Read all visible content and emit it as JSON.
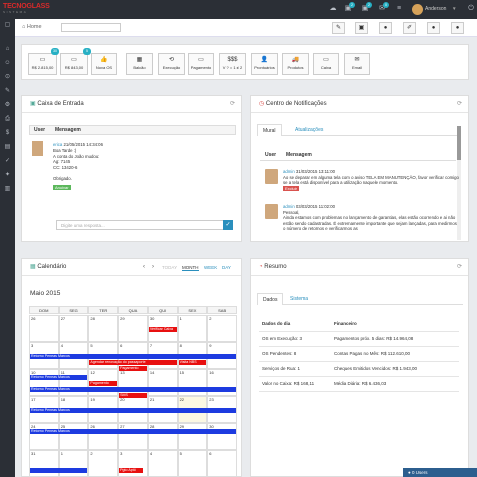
{
  "app": {
    "logo_main": "TECNOGLASS",
    "logo_sub": "SISTEMA"
  },
  "topbar": {
    "icons": [
      "cloud-icon",
      "chat-icon",
      "message-icon",
      "mail-icon",
      "list-icon"
    ],
    "badges": [
      "2",
      "2",
      "0"
    ],
    "user_name": "Anderson"
  },
  "breadcrumb": {
    "home": "Home"
  },
  "header_buttons": [
    "wrench-icon",
    "lock-icon",
    "info-icon",
    "edit-icon",
    "user-icon",
    "user2-icon"
  ],
  "shortcuts": [
    {
      "label": "R$ 2.815,00",
      "glyph": "▭",
      "badge": "30",
      "badge_color": "#27b0c4"
    },
    {
      "label": "R$ 843,00",
      "glyph": "▭",
      "badge": "5",
      "badge_color": "#27b0c4"
    },
    {
      "label": "Nova OS",
      "glyph": "👍",
      "badge": "",
      "badge_color": ""
    },
    {
      "label": "Balcão",
      "glyph": "▦",
      "badge": "",
      "badge_color": ""
    },
    {
      "label": "Execução",
      "glyph": "⟲",
      "badge": "",
      "badge_color": ""
    },
    {
      "label": "Pagamento",
      "glyph": "▭",
      "badge": "",
      "badge_color": ""
    },
    {
      "label": "V ? = 1 ≠ 2",
      "glyph": "$$$",
      "badge": "",
      "badge_color": ""
    },
    {
      "label": "Prontuários",
      "glyph": "👤",
      "badge": "",
      "badge_color": ""
    },
    {
      "label": "Produtos",
      "glyph": "🚚",
      "badge": "",
      "badge_color": ""
    },
    {
      "label": "Caixa",
      "glyph": "▭",
      "badge": "",
      "badge_color": ""
    },
    {
      "label": "Email",
      "glyph": "✉",
      "badge": "",
      "badge_color": ""
    }
  ],
  "inbox": {
    "title": "Caixa de Entrada",
    "col_user": "User",
    "col_msg": "Mensagem",
    "message": {
      "author": "erica",
      "date": "21/05/2015 14:34:06",
      "lines": [
        "Boa Tarde :)",
        "A conta do João mudou:",
        "Ag: 7145",
        "CC: 13420-6",
        "",
        "Obrigado."
      ],
      "attachment": "Anuivar"
    },
    "reply_placeholder": "Digite uma resposta..."
  },
  "notifications": {
    "title": "Centro de Notificações",
    "tabs": [
      "Mural",
      "Atualizações"
    ],
    "col_user": "User",
    "col_msg": "Mensagem",
    "items": [
      {
        "author": "admin",
        "date": "31/03/2015 13:11:00",
        "text": "Ao se deparar em alguma tela com o aviso TELA EM MANUTENÇÃO, favor verificar comigo se a tela está disponível para a utilização naquele momento.",
        "tag": "Excluir"
      },
      {
        "author": "admin",
        "date": "03/03/2015 11:02:00",
        "text": "Pessoal,\nAinda estamos com problemas no lançamento de garantias, elas estão ocorrendo e ai não estão sendo cadastradas. É extremamente importante que sejam lançadas, para medirmos o número de retornos e verificarmos as",
        "tag": ""
      }
    ]
  },
  "calendar": {
    "title": "Calendário",
    "views": [
      "TODAY",
      "MONTH",
      "WEEK",
      "DAY"
    ],
    "month": "Maio 2015",
    "weekdays": [
      "DOM",
      "SEG",
      "TER",
      "QUA",
      "QUI",
      "SEX",
      "SAB"
    ],
    "rows": [
      [
        "26",
        "27",
        "28",
        "29",
        "30",
        "1",
        "2"
      ],
      [
        "3",
        "4",
        "5",
        "6",
        "7",
        "8",
        "9"
      ],
      [
        "10",
        "11",
        "12",
        "13",
        "14",
        "15",
        "16"
      ],
      [
        "17",
        "18",
        "19",
        "20",
        "21",
        "22",
        "23"
      ],
      [
        "24",
        "25",
        "26",
        "27",
        "28",
        "29",
        "30"
      ],
      [
        "31",
        "1",
        "2",
        "3",
        "4",
        "5",
        "6"
      ]
    ],
    "events": [
      {
        "text": "Verificar Caixa",
        "color": "r"
      },
      {
        "text": "Retorno Peneas Marcos",
        "color": "b"
      },
      {
        "text": "Agendar renovação do passaporte",
        "color": "r"
      },
      {
        "text": "Visita NBS",
        "color": "r"
      },
      {
        "text": "Pagamento",
        "color": "r"
      },
      {
        "text": "Retorno Peneas Marcos",
        "color": "b"
      },
      {
        "text": "Pagamento",
        "color": "r"
      },
      {
        "text": "Retorno Peneas Marcos",
        "color": "b"
      },
      {
        "text": "SMS",
        "color": "r"
      },
      {
        "text": "Retorno Peneas Marcos",
        "color": "b"
      },
      {
        "text": "Retorno Peneas Marcos",
        "color": "b"
      },
      {
        "text": "Pgto Aptö",
        "color": "r"
      }
    ]
  },
  "resumo": {
    "title": "Resumo",
    "tabs": [
      "Dados",
      "Sistema"
    ],
    "head": [
      "Dados do dia",
      "Financeiro"
    ],
    "rows": [
      [
        "OS em Execução: 3",
        "Pagamentos próx. 5 dias: R$ 14.964,08"
      ],
      [
        "OS Pendentes: 8",
        "Contas Pagas no Mês: R$ 112.610,00"
      ],
      [
        "Serviços de Rua: 1",
        "Cheques Emitidos Vencidos: R$ 1.943,00"
      ],
      [
        "Valor no Caixa: R$ 168,11",
        "Média Diária: R$ 6.436,03"
      ]
    ]
  },
  "footer": {
    "online": "0 Users"
  }
}
